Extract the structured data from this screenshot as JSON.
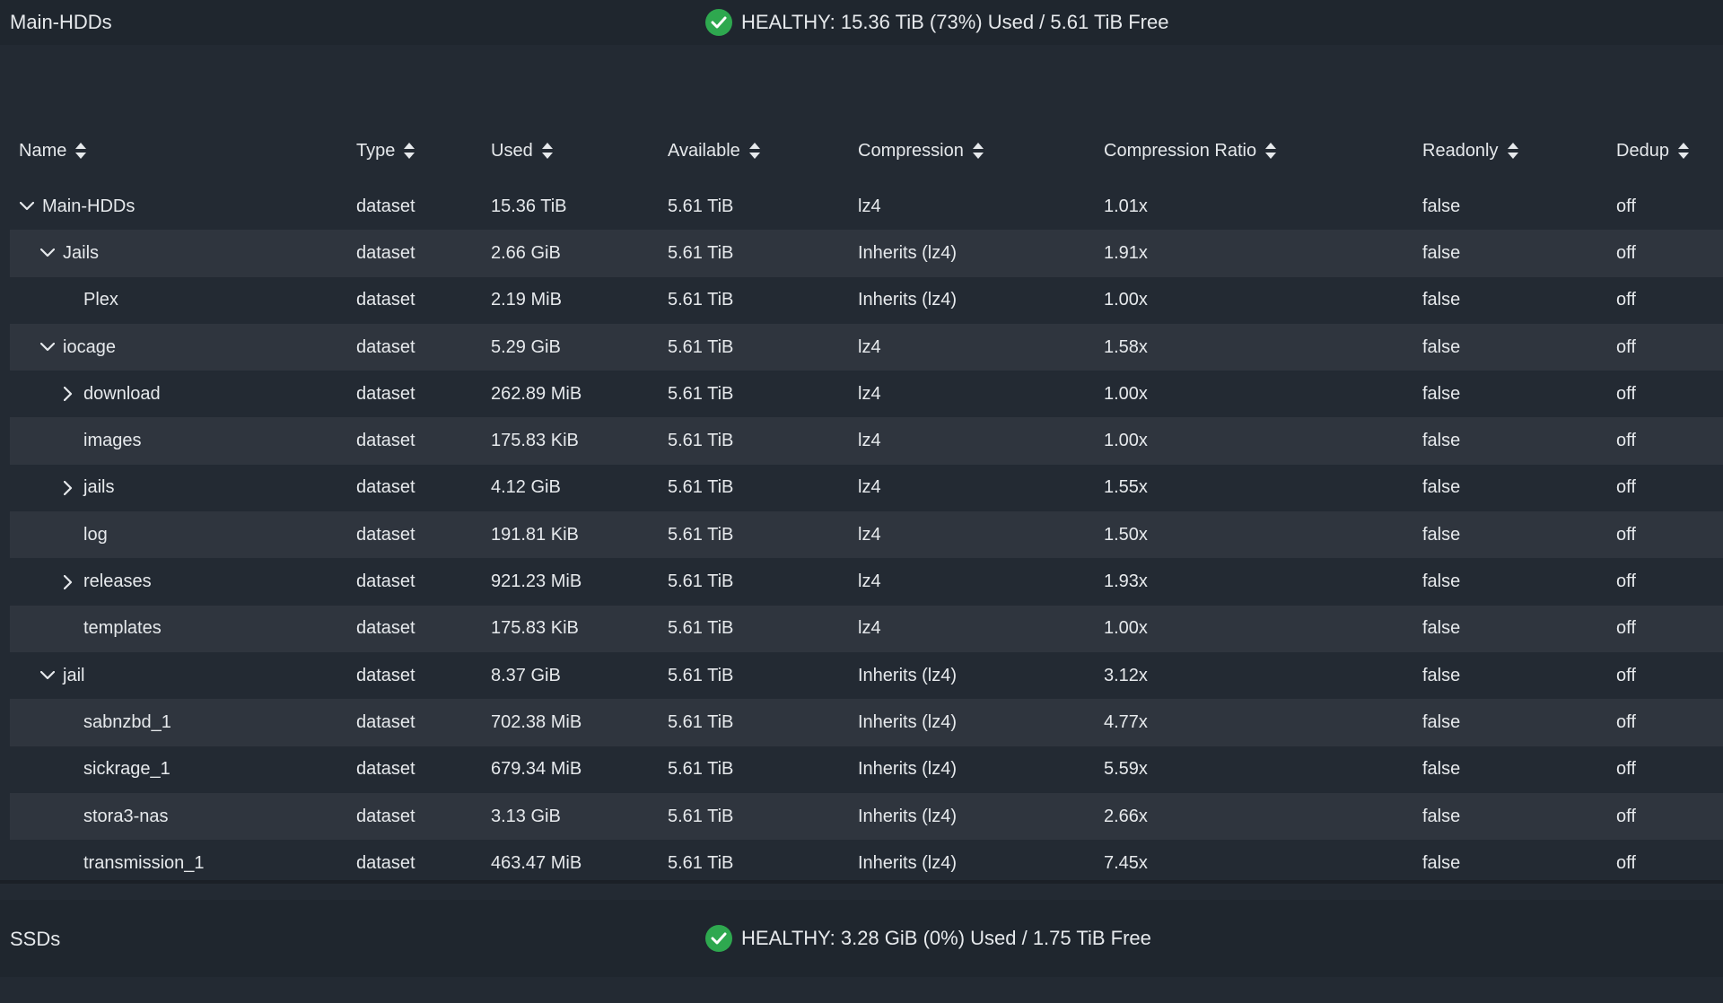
{
  "pools": [
    {
      "name": "Main-HDDs",
      "status": "HEALTHY: 15.36 TiB (73%) Used / 5.61 TiB Free"
    },
    {
      "name": "SSDs",
      "status": "HEALTHY: 3.28 GiB (0%) Used / 1.75 TiB Free"
    }
  ],
  "table": {
    "columns": [
      "Name",
      "Type",
      "Used",
      "Available",
      "Compression",
      "Compression Ratio",
      "Readonly",
      "Dedup"
    ],
    "rows": [
      {
        "name": "Main-HDDs",
        "level": 0,
        "toggle": "expanded",
        "type": "dataset",
        "used": "15.36 TiB",
        "available": "5.61 TiB",
        "compression": "lz4",
        "ratio": "1.01x",
        "readonly": "false",
        "dedup": "off"
      },
      {
        "name": "Jails",
        "level": 1,
        "toggle": "expanded",
        "type": "dataset",
        "used": "2.66 GiB",
        "available": "5.61 TiB",
        "compression": "Inherits (lz4)",
        "ratio": "1.91x",
        "readonly": "false",
        "dedup": "off"
      },
      {
        "name": "Plex",
        "level": 2,
        "toggle": "none",
        "type": "dataset",
        "used": "2.19 MiB",
        "available": "5.61 TiB",
        "compression": "Inherits (lz4)",
        "ratio": "1.00x",
        "readonly": "false",
        "dedup": "off"
      },
      {
        "name": "iocage",
        "level": 1,
        "toggle": "expanded",
        "type": "dataset",
        "used": "5.29 GiB",
        "available": "5.61 TiB",
        "compression": "lz4",
        "ratio": "1.58x",
        "readonly": "false",
        "dedup": "off"
      },
      {
        "name": "download",
        "level": 2,
        "toggle": "collapsed",
        "type": "dataset",
        "used": "262.89 MiB",
        "available": "5.61 TiB",
        "compression": "lz4",
        "ratio": "1.00x",
        "readonly": "false",
        "dedup": "off"
      },
      {
        "name": "images",
        "level": 2,
        "toggle": "none",
        "type": "dataset",
        "used": "175.83 KiB",
        "available": "5.61 TiB",
        "compression": "lz4",
        "ratio": "1.00x",
        "readonly": "false",
        "dedup": "off"
      },
      {
        "name": "jails",
        "level": 2,
        "toggle": "collapsed",
        "type": "dataset",
        "used": "4.12 GiB",
        "available": "5.61 TiB",
        "compression": "lz4",
        "ratio": "1.55x",
        "readonly": "false",
        "dedup": "off"
      },
      {
        "name": "log",
        "level": 2,
        "toggle": "none",
        "type": "dataset",
        "used": "191.81 KiB",
        "available": "5.61 TiB",
        "compression": "lz4",
        "ratio": "1.50x",
        "readonly": "false",
        "dedup": "off"
      },
      {
        "name": "releases",
        "level": 2,
        "toggle": "collapsed",
        "type": "dataset",
        "used": "921.23 MiB",
        "available": "5.61 TiB",
        "compression": "lz4",
        "ratio": "1.93x",
        "readonly": "false",
        "dedup": "off"
      },
      {
        "name": "templates",
        "level": 2,
        "toggle": "none",
        "type": "dataset",
        "used": "175.83 KiB",
        "available": "5.61 TiB",
        "compression": "lz4",
        "ratio": "1.00x",
        "readonly": "false",
        "dedup": "off"
      },
      {
        "name": "jail",
        "level": 1,
        "toggle": "expanded",
        "type": "dataset",
        "used": "8.37 GiB",
        "available": "5.61 TiB",
        "compression": "Inherits (lz4)",
        "ratio": "3.12x",
        "readonly": "false",
        "dedup": "off"
      },
      {
        "name": "sabnzbd_1",
        "level": 2,
        "toggle": "none",
        "type": "dataset",
        "used": "702.38 MiB",
        "available": "5.61 TiB",
        "compression": "Inherits (lz4)",
        "ratio": "4.77x",
        "readonly": "false",
        "dedup": "off"
      },
      {
        "name": "sickrage_1",
        "level": 2,
        "toggle": "none",
        "type": "dataset",
        "used": "679.34 MiB",
        "available": "5.61 TiB",
        "compression": "Inherits (lz4)",
        "ratio": "5.59x",
        "readonly": "false",
        "dedup": "off"
      },
      {
        "name": "stora3-nas",
        "level": 2,
        "toggle": "none",
        "type": "dataset",
        "used": "3.13 GiB",
        "available": "5.61 TiB",
        "compression": "Inherits (lz4)",
        "ratio": "2.66x",
        "readonly": "false",
        "dedup": "off"
      },
      {
        "name": "transmission_1",
        "level": 2,
        "toggle": "none",
        "type": "dataset",
        "used": "463.47 MiB",
        "available": "5.61 TiB",
        "compression": "Inherits (lz4)",
        "ratio": "7.45x",
        "readonly": "false",
        "dedup": "off"
      }
    ]
  },
  "colors": {
    "background": "#232a33",
    "header_background": "#1f262e",
    "alt_row": "#2f353e",
    "healthy": "#2ea84f",
    "text": "#e6e9ec"
  }
}
